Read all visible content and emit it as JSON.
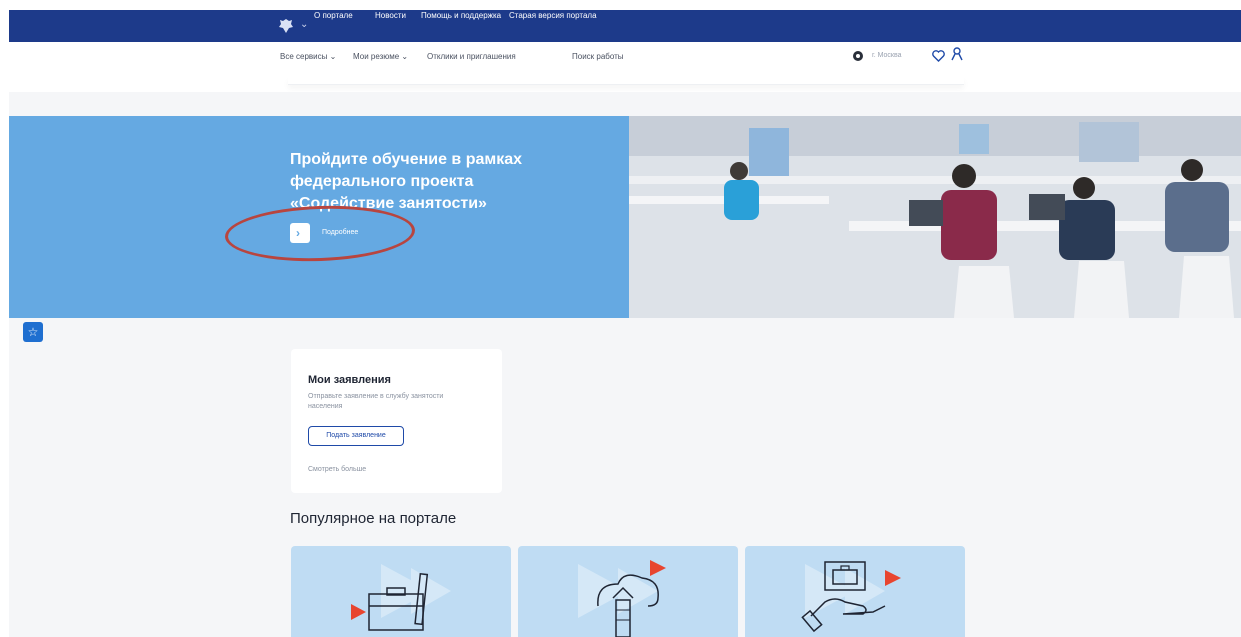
{
  "topnav": {
    "items": [
      "О портале",
      "Новости",
      "Помощь и поддержка",
      "Старая версия портала"
    ]
  },
  "subnav": {
    "items": [
      "Все сервисы",
      "Мои резюме",
      "Отклики и приглашения",
      "Поиск работы"
    ],
    "region": "г. Москва"
  },
  "hero": {
    "title_lines": [
      "Пройдите обучение в рамках",
      "федерального проекта",
      "«Содействие занятости»"
    ],
    "more_label": "Подробнее"
  },
  "my_applications": {
    "title": "Мои заявления",
    "description": "Отправьте заявление в службу занятости населения",
    "submit_button": "Подать заявление",
    "see_more": "Смотреть больше"
  },
  "popular": {
    "title": "Популярное на портале"
  },
  "colors": {
    "topbar": "#1d3a8a",
    "hero_blue": "#65a9e2",
    "accent_red": "#e8452f",
    "tile_bg": "#bfdcf3",
    "annotation": "#b8453f"
  }
}
